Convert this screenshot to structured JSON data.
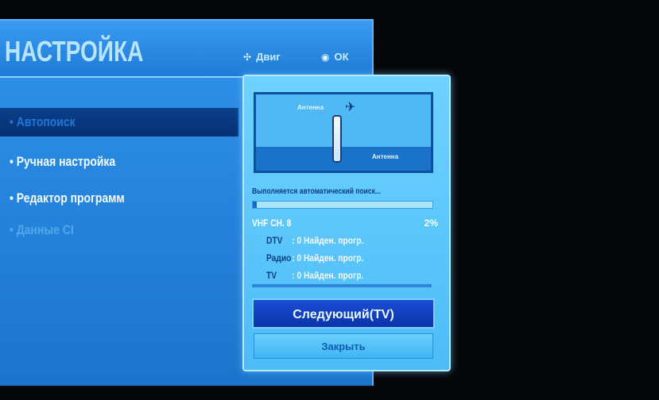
{
  "menu": {
    "title": "НАСТРОЙКА",
    "hint_move": "Двиг",
    "hint_ok": "ОК",
    "items": [
      {
        "label": "• Автопоиск"
      },
      {
        "label": "• Ручная настройка"
      },
      {
        "label": "• Редактор программ"
      },
      {
        "label": "• Данные CI"
      }
    ]
  },
  "dialog": {
    "preview_label_top": "Антенна",
    "preview_label_bottom": "Антенна",
    "status": "Выполняется автоматический поиск...",
    "progress_percent": 2,
    "channel": "VHF CH. 8",
    "percent_text": "2%",
    "results": [
      {
        "label": "DTV",
        "value": ": 0 Найден. прогр."
      },
      {
        "label": "Радио",
        "value": ": 0 Найден. прогр."
      },
      {
        "label": "TV",
        "value": ": 0 Найден. прогр."
      }
    ],
    "next_button": "Следующий(TV)",
    "close_button": "Закрыть"
  },
  "colors": {
    "accent": "#1a7fd8",
    "dialog": "#4cbcf6",
    "selected": "#0b3f8a"
  }
}
